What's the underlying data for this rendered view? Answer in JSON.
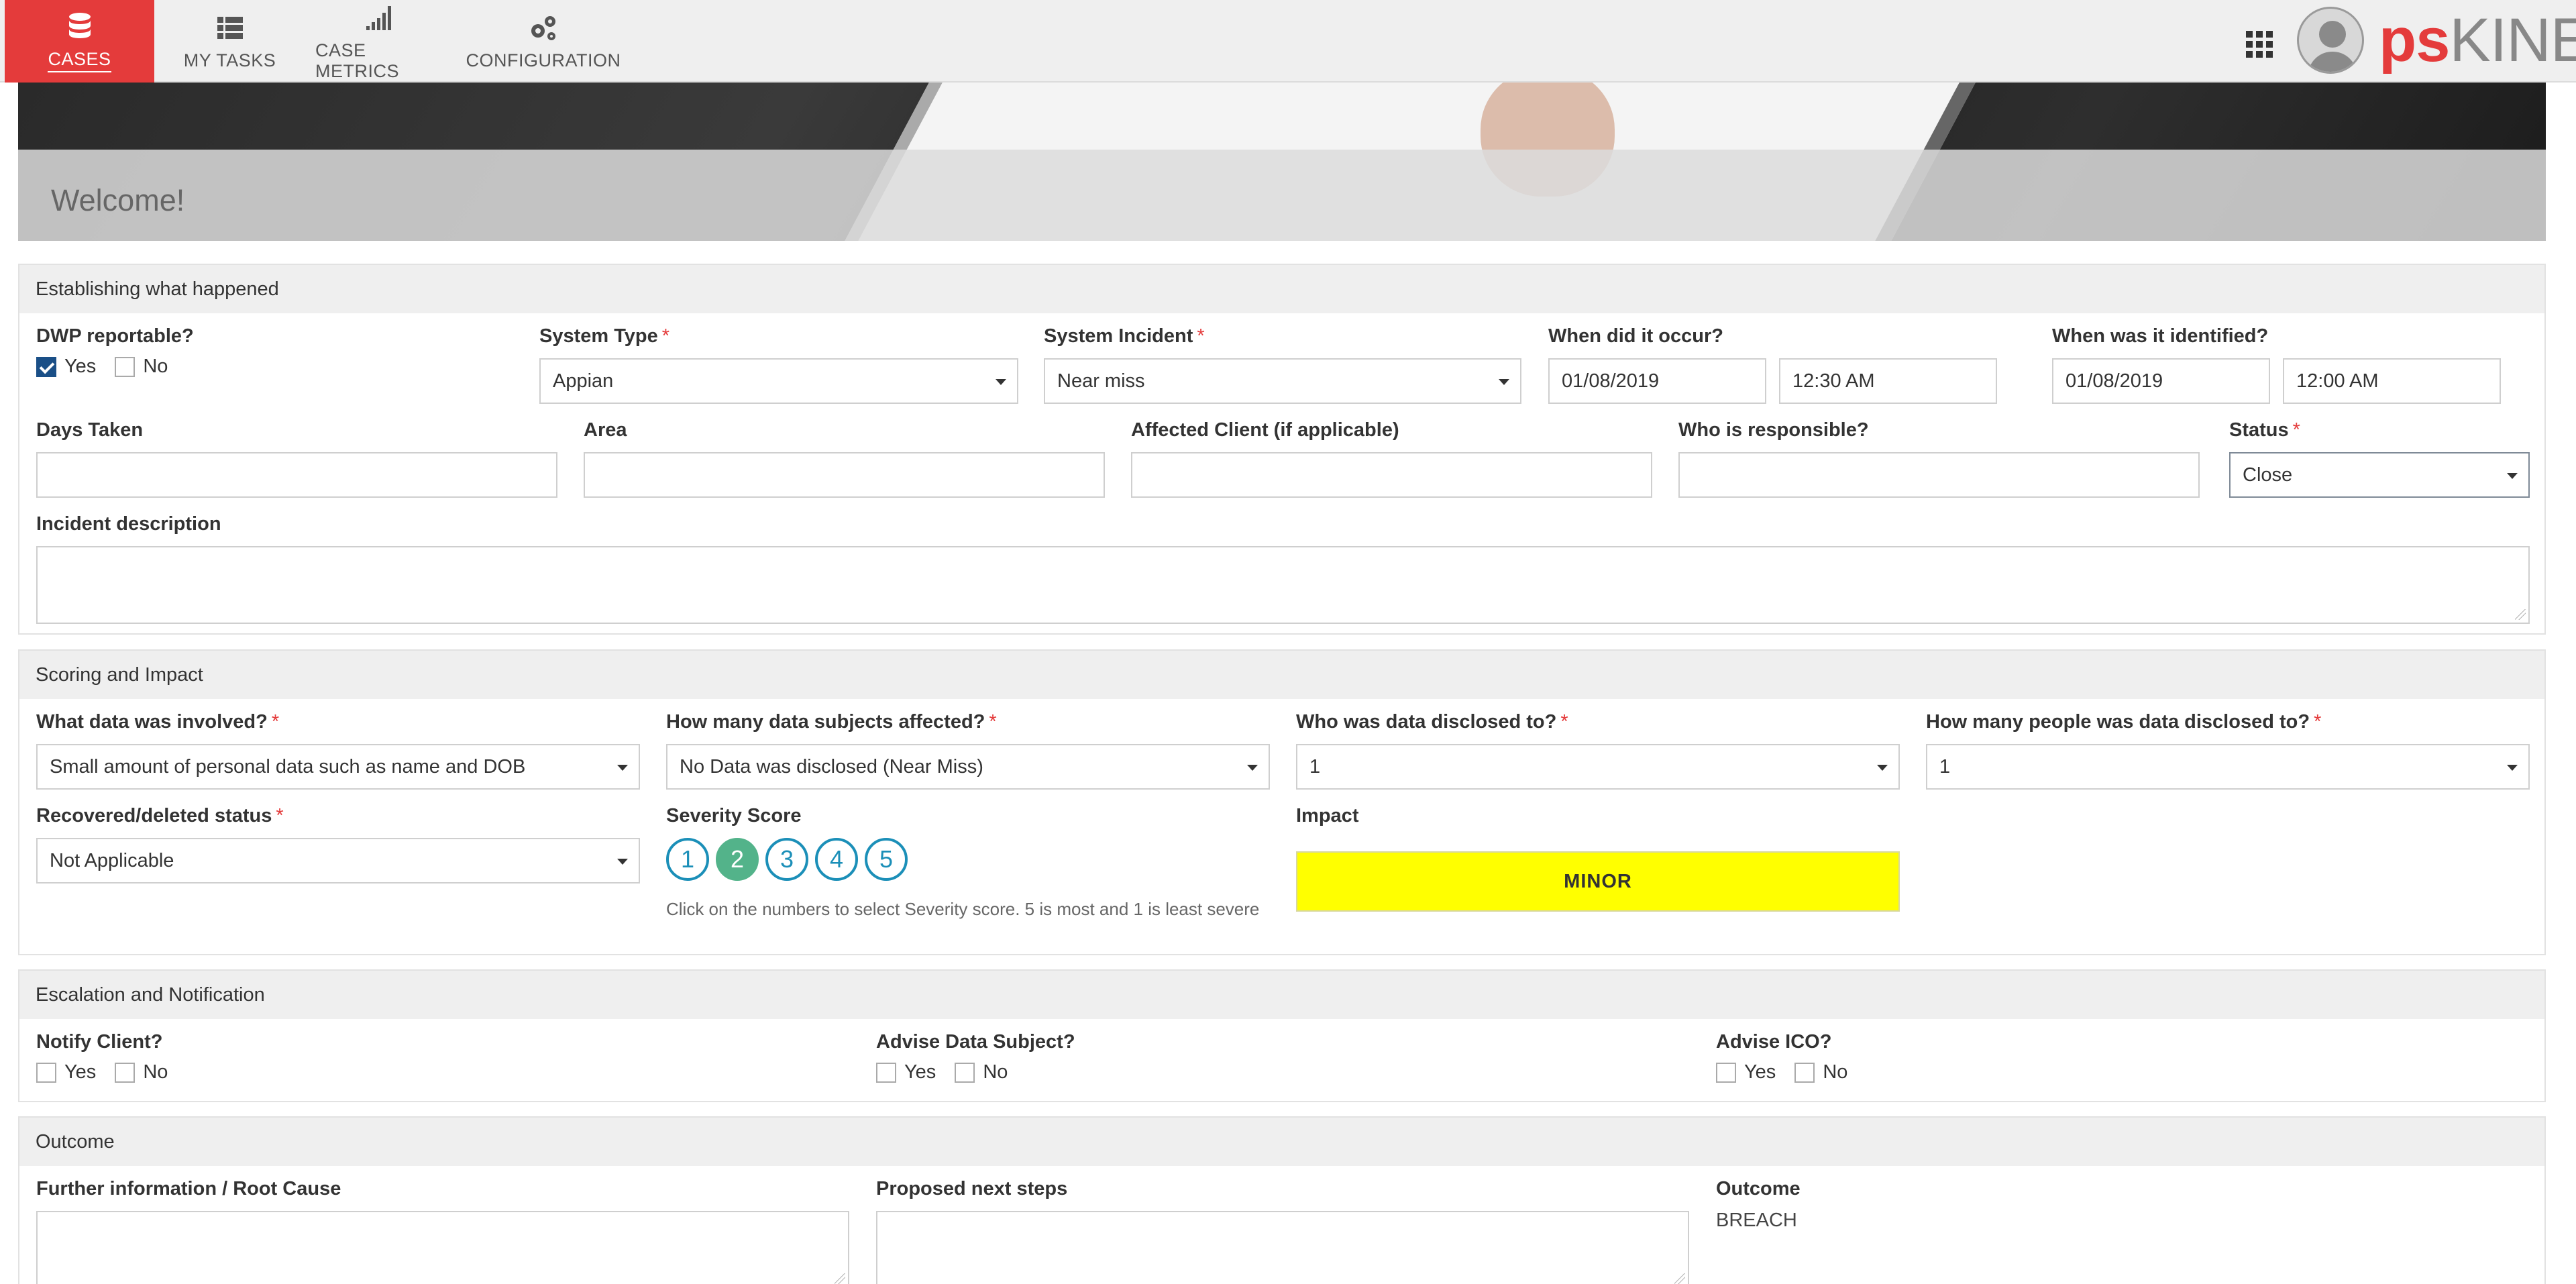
{
  "nav": {
    "tabs": [
      {
        "label": "CASES",
        "icon": "database-icon"
      },
      {
        "label": "MY TASKS",
        "icon": "list-icon"
      },
      {
        "label": "CASE METRICS",
        "icon": "signal-bars-icon"
      },
      {
        "label": "CONFIGURATION",
        "icon": "gears-icon"
      }
    ],
    "active_tab": "CASES",
    "logo_ps": "ps",
    "logo_kinetic": "KINETIC"
  },
  "banner": {
    "welcome": "Welcome!"
  },
  "section1": {
    "title": "Establishing what happened",
    "dwp": {
      "label": "DWP reportable?",
      "yes": "Yes",
      "no": "No",
      "yes_checked": true
    },
    "system_type": {
      "label": "System Type",
      "value": "Appian"
    },
    "system_incident": {
      "label": "System Incident",
      "value": "Near miss"
    },
    "when_occur": {
      "label": "When did it occur?",
      "date": "01/08/2019",
      "time": "12:30 AM"
    },
    "when_identified": {
      "label": "When was it identified?",
      "date": "01/08/2019",
      "time": "12:00 AM"
    },
    "days_taken": {
      "label": "Days Taken",
      "value": ""
    },
    "area": {
      "label": "Area",
      "value": ""
    },
    "affected_client": {
      "label": "Affected Client (if applicable)",
      "value": ""
    },
    "who_responsible": {
      "label": "Who is responsible?",
      "value": ""
    },
    "status": {
      "label": "Status",
      "value": "Close"
    },
    "incident_description": {
      "label": "Incident description",
      "value": ""
    }
  },
  "section2": {
    "title": "Scoring and Impact",
    "data_involved": {
      "label": "What data was involved?",
      "value": "Small amount of personal data such as name and DOB"
    },
    "subjects_affected": {
      "label": "How many data subjects affected?",
      "value": "No Data was disclosed (Near Miss)"
    },
    "disclosed_to": {
      "label": "Who was data disclosed to?",
      "value": "1"
    },
    "people_disclosed": {
      "label": "How many people was data disclosed to?",
      "value": "1"
    },
    "recovered_status": {
      "label": "Recovered/deleted status",
      "value": "Not Applicable"
    },
    "severity": {
      "label": "Severity Score",
      "options": [
        "1",
        "2",
        "3",
        "4",
        "5"
      ],
      "selected": "2",
      "help": "Click on the numbers to select Severity score. 5 is most and 1 is least severe"
    },
    "impact": {
      "label": "Impact",
      "value": "MINOR",
      "color": "#ffff00"
    }
  },
  "section3": {
    "title": "Escalation and Notification",
    "notify_client": {
      "label": "Notify Client?",
      "yes": "Yes",
      "no": "No"
    },
    "advise_subject": {
      "label": "Advise Data Subject?",
      "yes": "Yes",
      "no": "No"
    },
    "advise_ico": {
      "label": "Advise ICO?",
      "yes": "Yes",
      "no": "No"
    }
  },
  "section4": {
    "title": "Outcome",
    "further_info": {
      "label": "Further information / Root Cause",
      "value": ""
    },
    "next_steps": {
      "label": "Proposed next steps",
      "value": ""
    },
    "outcome": {
      "label": "Outcome",
      "value": "BREACH"
    }
  },
  "colors": {
    "brand_red": "#e43b3b",
    "severity_blue": "#1b8fb8",
    "severity_selected": "#53b38a",
    "impact_yellow": "#ffff00"
  }
}
